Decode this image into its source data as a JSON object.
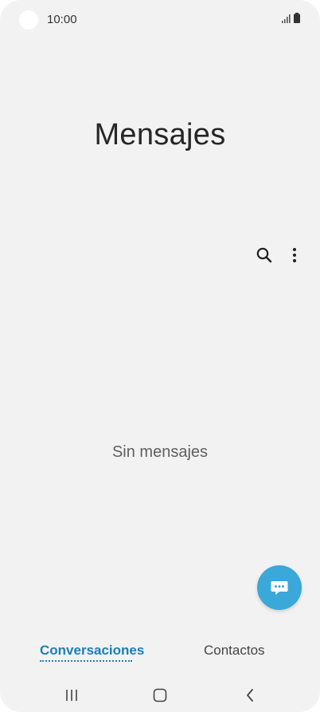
{
  "status_bar": {
    "time": "10:00",
    "signal_icon": "signal-icon",
    "battery_icon": "battery-icon"
  },
  "app": {
    "title": "Mensajes"
  },
  "toolbar": {
    "search_icon": "search-icon",
    "more_icon": "more-vertical-icon"
  },
  "empty_state": {
    "message": "Sin mensajes"
  },
  "fab": {
    "icon": "new-message-icon"
  },
  "tabs": [
    {
      "label": "Conversaciones",
      "active": true
    },
    {
      "label": "Contactos",
      "active": false
    }
  ],
  "nav": {
    "recents_icon": "recents-icon",
    "home_icon": "home-icon",
    "back_icon": "back-icon"
  },
  "colors": {
    "accent": "#1b7fb8",
    "fab": "#3aa8d8",
    "background": "#f2f2f2"
  }
}
